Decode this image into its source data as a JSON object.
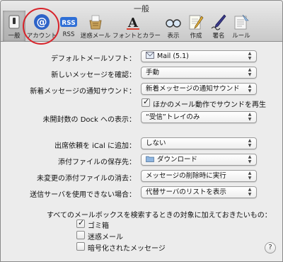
{
  "window": {
    "title": "一般"
  },
  "toolbar": {
    "items": [
      {
        "label": "一般",
        "icon": "switch-icon"
      },
      {
        "label": "アカウント",
        "icon": "at-sign-icon"
      },
      {
        "label": "RSS",
        "icon": "rss-icon"
      },
      {
        "label": "迷惑メール",
        "icon": "junk-mail-icon"
      },
      {
        "label": "フォントとカラー",
        "icon": "font-color-icon"
      },
      {
        "label": "表示",
        "icon": "glasses-icon"
      },
      {
        "label": "作成",
        "icon": "compose-pencil-icon"
      },
      {
        "label": "署名",
        "icon": "signature-pen-icon"
      },
      {
        "label": "ルール",
        "icon": "rules-icon"
      }
    ],
    "active_index": 0
  },
  "settings": {
    "default_mail_app": {
      "label": "デフォルトメールソフト：",
      "value": "Mail (5.1)"
    },
    "check_new": {
      "label": "新しいメッセージを確認：",
      "value": "手動"
    },
    "new_sound": {
      "label": "新着メッセージの通知サウンド：",
      "value": "新着メッセージの通知サウンド"
    },
    "play_other_sounds": {
      "label": "ほかのメール動作でサウンドを再生",
      "checked": true
    },
    "dock_unread": {
      "label": "未開封数の Dock への表示：",
      "value": "“受信”トレイのみ"
    },
    "ical_invites": {
      "label": "出席依頼を iCal に追加：",
      "value": "しない"
    },
    "downloads_folder": {
      "label": "添付ファイルの保存先：",
      "value": "ダウンロード"
    },
    "remove_unedited": {
      "label": "未変更の添付ファイルの消去：",
      "value": "メッセージの削除時に実行"
    },
    "outgoing_unavailable": {
      "label": "送信サーバを使用できない場合：",
      "value": "代替サーバのリストを表示"
    }
  },
  "search": {
    "heading": "すべてのメールボックスを検索するときの対象に加えておきたいもの：",
    "options": [
      {
        "label": "ゴミ箱",
        "checked": true
      },
      {
        "label": "迷惑メール",
        "checked": false
      },
      {
        "label": "暗号化されたメッセージ",
        "checked": false
      }
    ]
  },
  "help": {
    "label": "?"
  },
  "colors": {
    "highlight_circle": "#d8232a",
    "rss_blue": "#2f6fd6"
  }
}
